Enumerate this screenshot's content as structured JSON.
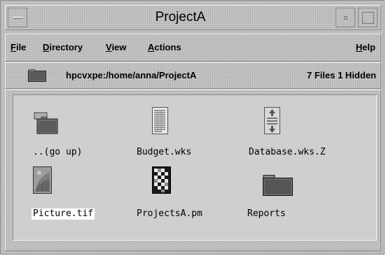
{
  "window": {
    "title": "ProjectA"
  },
  "menubar": {
    "file": "File",
    "directory": "Directory",
    "view": "View",
    "actions": "Actions",
    "help": "Help"
  },
  "pathbar": {
    "path": "hpcvxpe:/home/anna/ProjectA",
    "file_count": "7 Files 1 Hidden",
    "icon": "folder-icon"
  },
  "files": [
    {
      "name": "..(go up)",
      "icon": "parent-folder-icon",
      "selected": false
    },
    {
      "name": "Budget.wks",
      "icon": "spreadsheet-document-icon",
      "selected": false
    },
    {
      "name": "Database.wks.Z",
      "icon": "compressed-file-icon",
      "selected": false
    },
    {
      "name": "Picture.tif",
      "icon": "image-file-icon",
      "selected": true
    },
    {
      "name": "ProjectsA.pm",
      "icon": "pixmap-file-icon",
      "selected": false
    },
    {
      "name": "Reports",
      "icon": "folder-icon",
      "selected": false
    }
  ]
}
